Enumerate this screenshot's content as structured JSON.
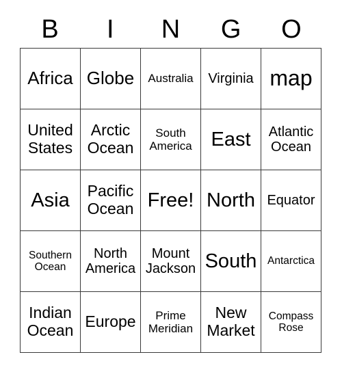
{
  "card": {
    "title_letters": [
      "B",
      "I",
      "N",
      "G",
      "O"
    ],
    "columns": 5,
    "rows": 5,
    "border_color": "#3a3a3a",
    "text_color": "#000000",
    "background_color": "#ffffff",
    "cells": [
      [
        {
          "label": "Africa",
          "size": "lg"
        },
        {
          "label": "Globe",
          "size": "lg"
        },
        {
          "label": "Australia",
          "size": "xs"
        },
        {
          "label": "Virginia",
          "size": "sm"
        },
        {
          "label": "map",
          "size": "xxl"
        }
      ],
      [
        {
          "label": "United States",
          "size": "md"
        },
        {
          "label": "Arctic Ocean",
          "size": "md"
        },
        {
          "label": "South America",
          "size": "xs"
        },
        {
          "label": "East",
          "size": "xl"
        },
        {
          "label": "Atlantic Ocean",
          "size": "sm"
        }
      ],
      [
        {
          "label": "Asia",
          "size": "xl"
        },
        {
          "label": "Pacific Ocean",
          "size": "md"
        },
        {
          "label": "Free!",
          "size": "xl"
        },
        {
          "label": "North",
          "size": "xl"
        },
        {
          "label": "Equator",
          "size": "sm"
        }
      ],
      [
        {
          "label": "Southern Ocean",
          "size": "xxs"
        },
        {
          "label": "North America",
          "size": "sm"
        },
        {
          "label": "Mount Jackson",
          "size": "sm"
        },
        {
          "label": "South",
          "size": "xl"
        },
        {
          "label": "Antarctica",
          "size": "xxs"
        }
      ],
      [
        {
          "label": "Indian Ocean",
          "size": "md"
        },
        {
          "label": "Europe",
          "size": "md"
        },
        {
          "label": "Prime Meridian",
          "size": "xs"
        },
        {
          "label": "New Market",
          "size": "md"
        },
        {
          "label": "Compass Rose",
          "size": "xxs"
        }
      ]
    ]
  }
}
